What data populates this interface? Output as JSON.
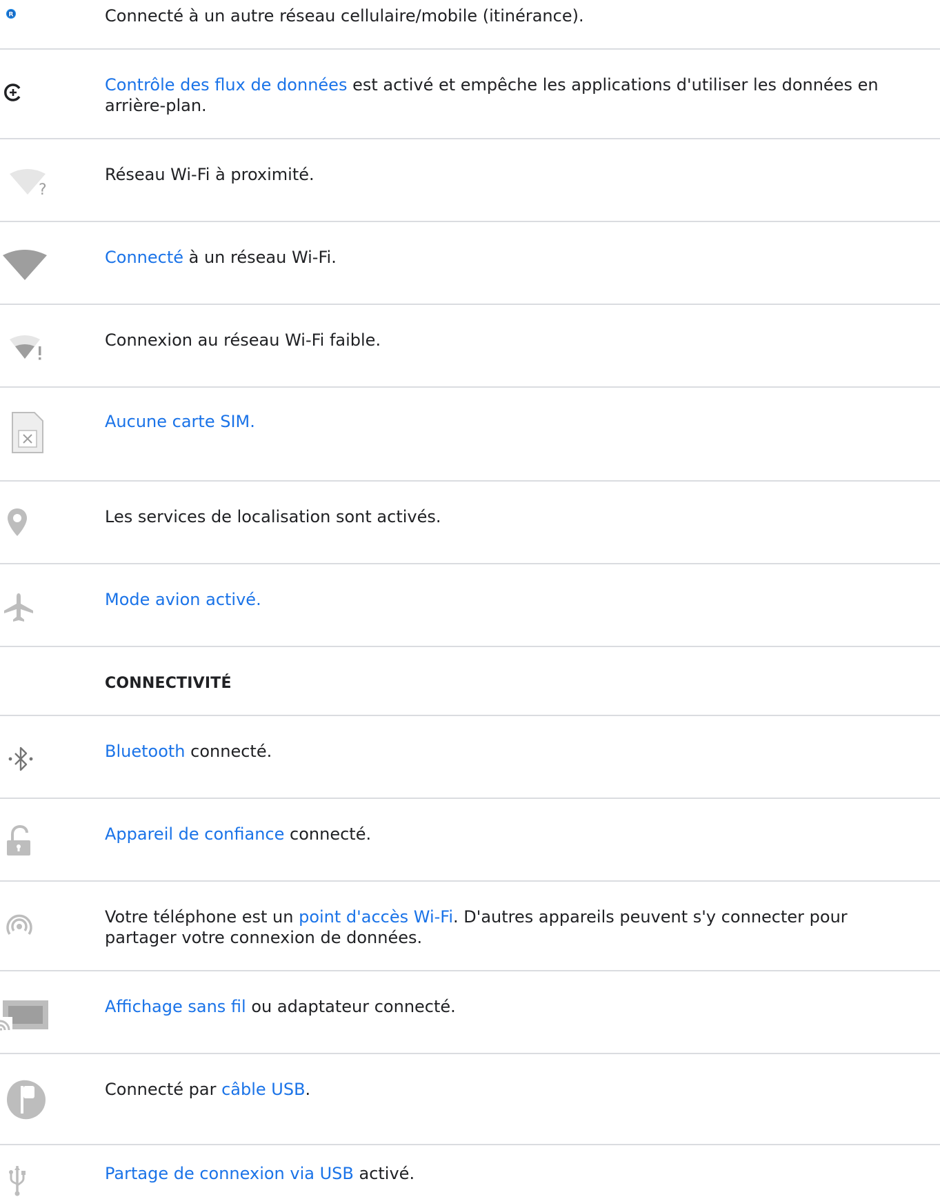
{
  "rows": [
    {
      "icon": "roaming-r-icon",
      "plain": "Connecté à un autre réseau cellulaire/mobile (itinérance)."
    },
    {
      "icon": "data-saver-icon",
      "link": "Contrôle des flux de données",
      "after": " est activé et empêche les applications d'utiliser les données en arrière-plan."
    },
    {
      "icon": "wifi-question-icon",
      "plain": "Réseau Wi-Fi à proximité."
    },
    {
      "icon": "wifi-full-icon",
      "link": "Connecté",
      "after": " à un réseau Wi-Fi."
    },
    {
      "icon": "wifi-weak-icon",
      "plain": "Connexion au réseau Wi-Fi faible."
    },
    {
      "icon": "no-sim-icon",
      "link": "Aucune carte SIM."
    },
    {
      "icon": "location-icon",
      "plain": "Les services de localisation sont activés."
    },
    {
      "icon": "airplane-icon",
      "link": "Mode avion activé."
    },
    {
      "heading": "CONNECTIVITÉ"
    },
    {
      "icon": "bluetooth-icon",
      "link": "Bluetooth",
      "after": " connecté."
    },
    {
      "icon": "unlock-icon",
      "link": "Appareil de confiance",
      "after": " connecté."
    },
    {
      "icon": "hotspot-icon",
      "before": "Votre téléphone est un ",
      "link": "point d'accès Wi-Fi",
      "after": ". D'autres appareils peuvent s'y connecter pour partager votre connexion de données."
    },
    {
      "icon": "cast-icon",
      "link": "Affichage sans fil",
      "after": " ou adaptateur connecté."
    },
    {
      "icon": "usb-connected-icon",
      "before": "Connecté par ",
      "link": "câble USB",
      "after": "."
    },
    {
      "icon": "usb-tethering-icon",
      "link": "Partage de connexion via USB",
      "after": " activé."
    }
  ],
  "colors": {
    "link": "#1a73e8",
    "text": "#202124",
    "icon": "#9e9e9e",
    "divider": "#dadce0"
  }
}
